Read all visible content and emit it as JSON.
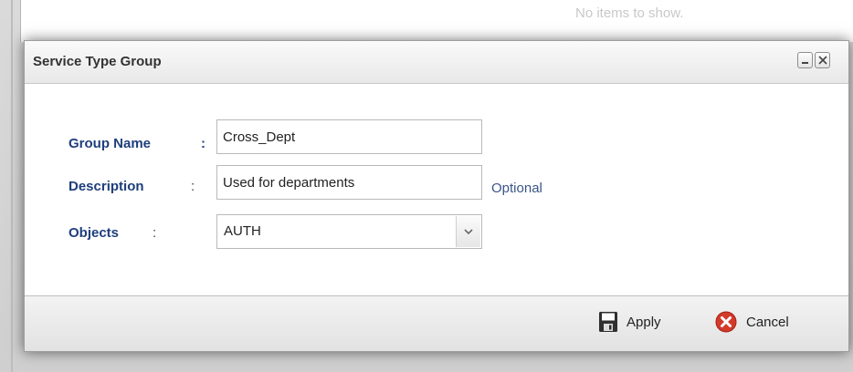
{
  "background": {
    "empty_text": "No items to show."
  },
  "dialog": {
    "title": "Service Type Group",
    "title_icons": [
      "minimize-icon",
      "close-icon"
    ]
  },
  "form": {
    "group_name": {
      "label": "Group Name",
      "colon": ":",
      "value": "Cross_Dept"
    },
    "description": {
      "label": "Description",
      "colon": ":",
      "value": "Used for departments",
      "hint": "Optional"
    },
    "objects": {
      "label": "Objects",
      "colon": ":",
      "selected": "AUTH"
    }
  },
  "footer": {
    "apply_label": "Apply",
    "cancel_label": "Cancel"
  },
  "colors": {
    "label_blue": "#1e3f7c",
    "cancel_red": "#d23a2a"
  }
}
